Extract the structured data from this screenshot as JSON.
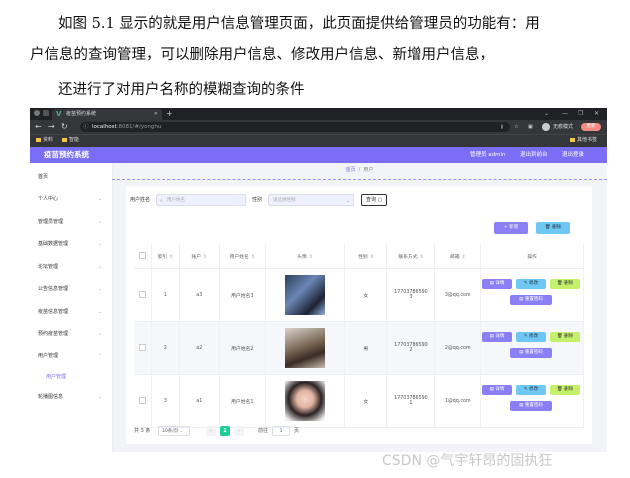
{
  "paragraphs": {
    "p1": "如图 5.1 显示的就是用户信息管理页面，此页面提供给管理员的功能有：用",
    "p2": "户信息的查询管理，可以删除用户信息、修改用户信息、新增用户信息，",
    "p3": "还进行了对用户名称的模糊查询的条件"
  },
  "browser": {
    "tab_title": "疫苗预约系统",
    "url_host": "localhost",
    "url_path": ":8081/#/yonghu",
    "mode_label": "无痕模式",
    "update_label": "更新",
    "bookmarks": [
      "资料",
      "智能"
    ],
    "bookmarks_right": "其他书签"
  },
  "header": {
    "brand": "疫苗预约系统",
    "admin": "管理员 admin",
    "to_front": "退出到前台",
    "logout": "退出登录"
  },
  "sidebar": {
    "items": [
      "首页",
      "个人中心",
      "管理员管理",
      "基础数据管理",
      "论坛管理",
      "公告信息管理",
      "疫苗信息管理",
      "预约疫苗管理",
      "用户管理"
    ],
    "sub_active": "用户管理",
    "last": "轮播图信息"
  },
  "breadcrumb": {
    "home": "首页",
    "current": "用户"
  },
  "filters": {
    "name_label": "用户姓名",
    "name_placeholder": "用户姓名",
    "gender_label": "性别",
    "gender_placeholder": "请选择性别",
    "query_label": "查询"
  },
  "actions": {
    "add": "新增",
    "delete": "删除"
  },
  "table": {
    "headers": [
      "",
      "索引",
      "账户",
      "用户姓名",
      "头像",
      "性别",
      "联系方式",
      "邮箱",
      "操作"
    ],
    "rows": [
      {
        "index": "1",
        "account": "a3",
        "name": "用户姓名3",
        "gender": "女",
        "phone_a": "17703786590",
        "phone_b": "3",
        "email": "3@qq.com"
      },
      {
        "index": "2",
        "account": "a2",
        "name": "用户姓名2",
        "gender": "男",
        "phone_a": "17703786590",
        "phone_b": "2",
        "email": "2@qq.com"
      },
      {
        "index": "3",
        "account": "a1",
        "name": "用户姓名1",
        "gender": "女",
        "phone_a": "17703786590",
        "phone_b": "1",
        "email": "1@qq.com"
      }
    ],
    "op_detail": "详情",
    "op_edit": "修改",
    "op_delete": "删除",
    "op_reset": "重置密码"
  },
  "pagination": {
    "total": "共 3 条",
    "size": "10条/页",
    "current": "1",
    "goto": "前往",
    "page_input": "1",
    "page_unit": "页"
  },
  "watermark": "CSDN @气宇轩昂的固执狂"
}
